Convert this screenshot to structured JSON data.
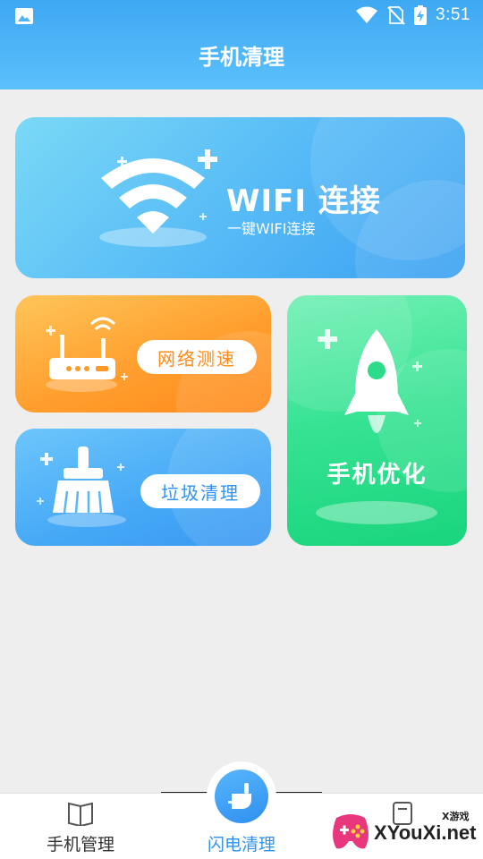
{
  "status_bar": {
    "time": "3:51"
  },
  "header": {
    "title": "手机清理"
  },
  "cards": {
    "wifi": {
      "title": "WIFI 连接",
      "subtitle": "一键WIFI连接"
    },
    "speed": {
      "label": "网络测速"
    },
    "junk": {
      "label": "垃圾清理"
    },
    "optimize": {
      "label": "手机优化"
    }
  },
  "bottom_nav": {
    "items": [
      {
        "label": "手机管理",
        "icon": "book-icon"
      },
      {
        "label": "闪电清理",
        "icon": "broom-icon",
        "active": true
      },
      {
        "label": "",
        "icon": "tablet-icon"
      }
    ],
    "active_color": "#2f93ee"
  },
  "watermark": {
    "text": "XYouXi.net",
    "small": "X游戏"
  },
  "colors": {
    "accent": "#3ea8f3",
    "orange": "#ff8c1a",
    "green": "#1ed47e"
  }
}
